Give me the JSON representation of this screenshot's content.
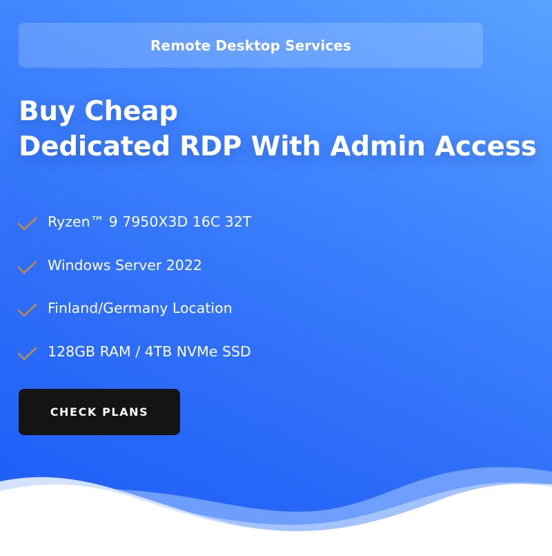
{
  "badge": {
    "label": "Remote Desktop Services"
  },
  "headline": {
    "line1": "Buy Cheap",
    "line2": "Dedicated RDP With Admin Access"
  },
  "features": [
    {
      "icon": "checkmark-icon",
      "text": "Ryzen™ 9 7950X3D 16C 32T"
    },
    {
      "icon": "checkmark-icon",
      "text": "Windows Server 2022"
    },
    {
      "icon": "checkmark-icon",
      "text": "Finland/Germany Location"
    },
    {
      "icon": "checkmark-icon",
      "text": "128GB RAM / 4TB NVMe SSD"
    }
  ],
  "cta": {
    "label": "CHECK PLANS"
  },
  "colors": {
    "background_top": "#5aa2ff",
    "background_bottom": "#1a5af7",
    "checkmark": "#c08a4a",
    "button_background": "#141414",
    "text": "#ffffff"
  }
}
